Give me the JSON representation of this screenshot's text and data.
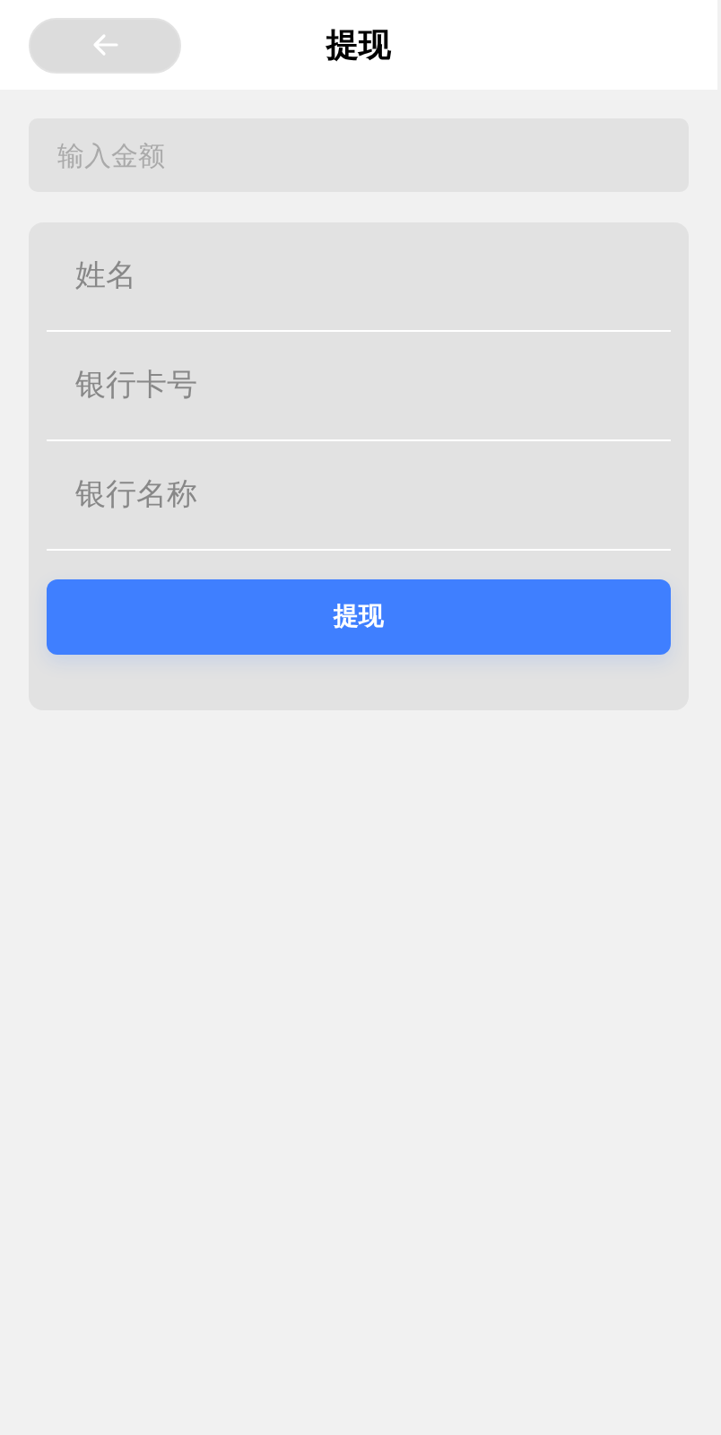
{
  "header": {
    "title": "提现"
  },
  "amount": {
    "placeholder": "输入金额"
  },
  "fields": [
    {
      "placeholder": "姓名"
    },
    {
      "placeholder": "银行卡号"
    },
    {
      "placeholder": "银行名称"
    }
  ],
  "submit": {
    "label": "提现"
  }
}
